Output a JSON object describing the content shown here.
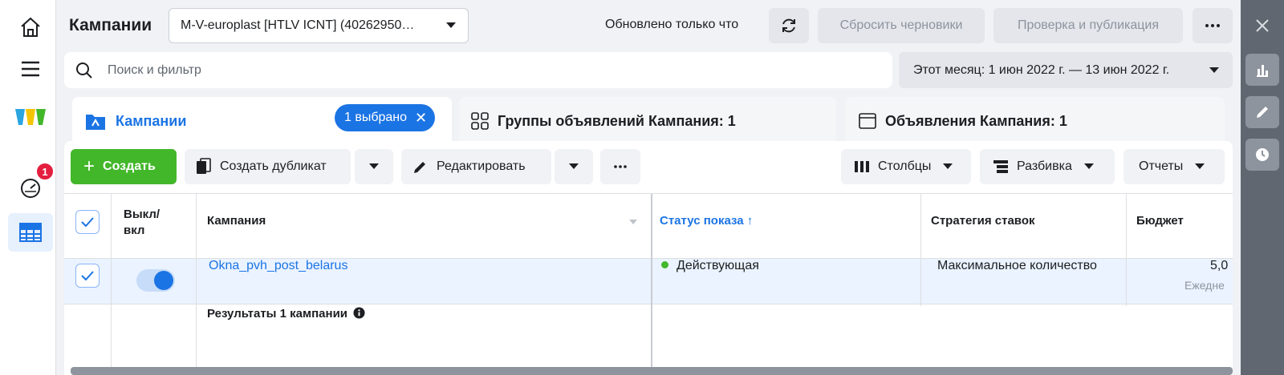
{
  "header": {
    "title": "Кампании",
    "account": "M-V-europlast [HTLV ICNT] (40262950…",
    "updated": "Обновлено только что",
    "reset_drafts": "Сбросить черновики",
    "review_publish": "Проверка и публикация"
  },
  "nav": {
    "badge_count": "1"
  },
  "search": {
    "placeholder": "Поиск и фильтр"
  },
  "daterange": {
    "label": "Этот месяц: 1 июн 2022 г. — 13 июн 2022 г."
  },
  "tabs": {
    "campaigns": "Кампании",
    "selected": "1 выбрано",
    "ad_groups": "Группы объявлений Кампания: 1",
    "ads": "Объявления Кампания: 1"
  },
  "toolbar": {
    "create": "Создать",
    "duplicate": "Создать дубликат",
    "edit": "Редактировать",
    "columns": "Столбцы",
    "breakdown": "Разбивка",
    "reports": "Отчеты"
  },
  "table": {
    "columns": {
      "toggle": "Выкл/\nвкл",
      "campaign": "Кампания",
      "delivery": "Статус показа",
      "bid_strategy": "Стратегия ставок",
      "budget": "Бюджет"
    },
    "rows": [
      {
        "name": "Okna_pvh_post_belarus",
        "delivery": "Действующая",
        "bid_strategy": "Максимальное количество",
        "budget": "5,0",
        "budget_type": "Ежедне"
      }
    ],
    "results": "Результаты 1 кампании"
  },
  "colors": {
    "accent": "#1b74e4",
    "create": "#42b72a",
    "active_status": "#42b72a"
  }
}
